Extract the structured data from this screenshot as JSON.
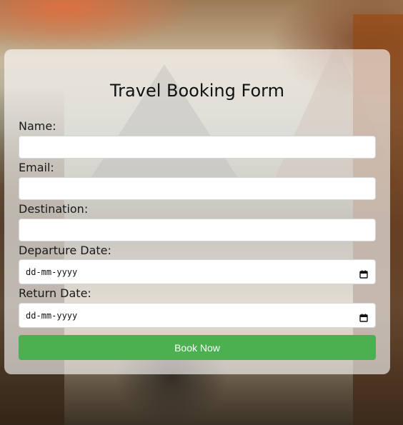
{
  "form": {
    "title": "Travel Booking Form",
    "fields": {
      "name": {
        "label": "Name:",
        "value": ""
      },
      "email": {
        "label": "Email:",
        "value": ""
      },
      "destination": {
        "label": "Destination:",
        "value": ""
      },
      "departure_date": {
        "label": "Departure Date:",
        "placeholder": "dd-mm-yyyy"
      },
      "return_date": {
        "label": "Return Date:",
        "placeholder": "dd-mm-yyyy"
      }
    },
    "submit_label": "Book Now"
  },
  "colors": {
    "button_background": "#4caf50",
    "button_text": "#ffffff",
    "card_background": "rgba(255,255,255,0.62)"
  },
  "icons": {
    "date_picker": "calendar-icon"
  }
}
